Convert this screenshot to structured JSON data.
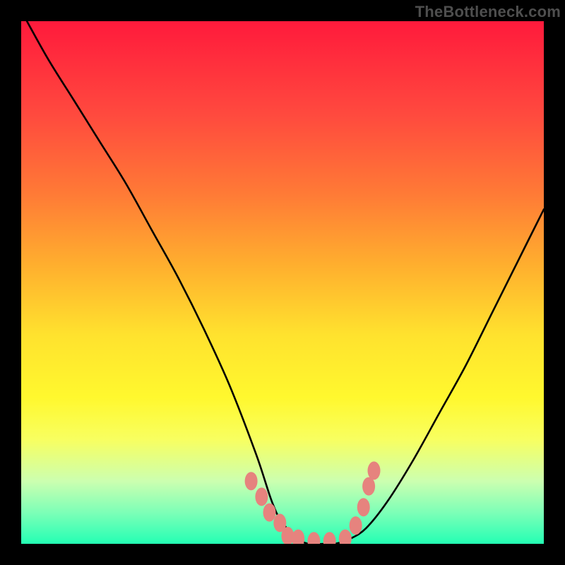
{
  "watermark": "TheBottleneck.com",
  "colors": {
    "frame": "#000000",
    "curve_stroke": "#000000",
    "marker_fill": "#e6837e",
    "gradient_top": "#ff1a3c",
    "gradient_bottom": "#24ffb4"
  },
  "chart_data": {
    "type": "line",
    "title": "",
    "xlabel": "",
    "ylabel": "",
    "xlim": [
      0,
      100
    ],
    "ylim": [
      0,
      100
    ],
    "grid": false,
    "series": [
      {
        "name": "bottleneck_curve",
        "x": [
          0,
          5,
          10,
          15,
          20,
          25,
          30,
          35,
          40,
          45,
          48,
          50,
          53,
          55,
          58,
          60,
          63,
          66,
          70,
          75,
          80,
          85,
          90,
          95,
          100
        ],
        "y": [
          102,
          93,
          85,
          77,
          69,
          60,
          51,
          41,
          30,
          17,
          8,
          4,
          1,
          0,
          0,
          0,
          1,
          3,
          8,
          16,
          25,
          34,
          44,
          54,
          64
        ]
      }
    ],
    "markers": [
      {
        "x": 44.0,
        "y": 12.0
      },
      {
        "x": 46.0,
        "y": 9.0
      },
      {
        "x": 47.5,
        "y": 6.0
      },
      {
        "x": 49.5,
        "y": 4.0
      },
      {
        "x": 51.0,
        "y": 1.5
      },
      {
        "x": 53.0,
        "y": 1.0
      },
      {
        "x": 56.0,
        "y": 0.5
      },
      {
        "x": 59.0,
        "y": 0.5
      },
      {
        "x": 62.0,
        "y": 1.0
      },
      {
        "x": 64.0,
        "y": 3.5
      },
      {
        "x": 65.5,
        "y": 7.0
      },
      {
        "x": 66.5,
        "y": 11.0
      },
      {
        "x": 67.5,
        "y": 14.0
      }
    ]
  }
}
